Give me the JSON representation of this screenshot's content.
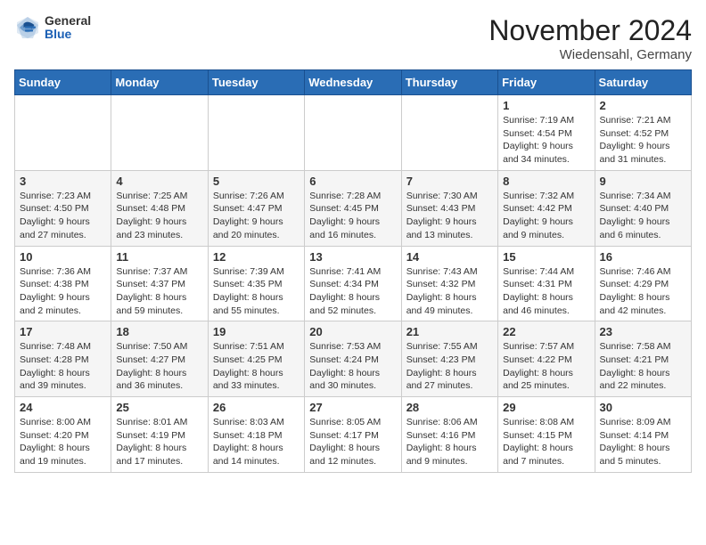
{
  "header": {
    "logo_general": "General",
    "logo_blue": "Blue",
    "month_title": "November 2024",
    "location": "Wiedensahl, Germany"
  },
  "days_of_week": [
    "Sunday",
    "Monday",
    "Tuesday",
    "Wednesday",
    "Thursday",
    "Friday",
    "Saturday"
  ],
  "weeks": [
    [
      {
        "day": "",
        "info": ""
      },
      {
        "day": "",
        "info": ""
      },
      {
        "day": "",
        "info": ""
      },
      {
        "day": "",
        "info": ""
      },
      {
        "day": "",
        "info": ""
      },
      {
        "day": "1",
        "info": "Sunrise: 7:19 AM\nSunset: 4:54 PM\nDaylight: 9 hours and 34 minutes."
      },
      {
        "day": "2",
        "info": "Sunrise: 7:21 AM\nSunset: 4:52 PM\nDaylight: 9 hours and 31 minutes."
      }
    ],
    [
      {
        "day": "3",
        "info": "Sunrise: 7:23 AM\nSunset: 4:50 PM\nDaylight: 9 hours and 27 minutes."
      },
      {
        "day": "4",
        "info": "Sunrise: 7:25 AM\nSunset: 4:48 PM\nDaylight: 9 hours and 23 minutes."
      },
      {
        "day": "5",
        "info": "Sunrise: 7:26 AM\nSunset: 4:47 PM\nDaylight: 9 hours and 20 minutes."
      },
      {
        "day": "6",
        "info": "Sunrise: 7:28 AM\nSunset: 4:45 PM\nDaylight: 9 hours and 16 minutes."
      },
      {
        "day": "7",
        "info": "Sunrise: 7:30 AM\nSunset: 4:43 PM\nDaylight: 9 hours and 13 minutes."
      },
      {
        "day": "8",
        "info": "Sunrise: 7:32 AM\nSunset: 4:42 PM\nDaylight: 9 hours and 9 minutes."
      },
      {
        "day": "9",
        "info": "Sunrise: 7:34 AM\nSunset: 4:40 PM\nDaylight: 9 hours and 6 minutes."
      }
    ],
    [
      {
        "day": "10",
        "info": "Sunrise: 7:36 AM\nSunset: 4:38 PM\nDaylight: 9 hours and 2 minutes."
      },
      {
        "day": "11",
        "info": "Sunrise: 7:37 AM\nSunset: 4:37 PM\nDaylight: 8 hours and 59 minutes."
      },
      {
        "day": "12",
        "info": "Sunrise: 7:39 AM\nSunset: 4:35 PM\nDaylight: 8 hours and 55 minutes."
      },
      {
        "day": "13",
        "info": "Sunrise: 7:41 AM\nSunset: 4:34 PM\nDaylight: 8 hours and 52 minutes."
      },
      {
        "day": "14",
        "info": "Sunrise: 7:43 AM\nSunset: 4:32 PM\nDaylight: 8 hours and 49 minutes."
      },
      {
        "day": "15",
        "info": "Sunrise: 7:44 AM\nSunset: 4:31 PM\nDaylight: 8 hours and 46 minutes."
      },
      {
        "day": "16",
        "info": "Sunrise: 7:46 AM\nSunset: 4:29 PM\nDaylight: 8 hours and 42 minutes."
      }
    ],
    [
      {
        "day": "17",
        "info": "Sunrise: 7:48 AM\nSunset: 4:28 PM\nDaylight: 8 hours and 39 minutes."
      },
      {
        "day": "18",
        "info": "Sunrise: 7:50 AM\nSunset: 4:27 PM\nDaylight: 8 hours and 36 minutes."
      },
      {
        "day": "19",
        "info": "Sunrise: 7:51 AM\nSunset: 4:25 PM\nDaylight: 8 hours and 33 minutes."
      },
      {
        "day": "20",
        "info": "Sunrise: 7:53 AM\nSunset: 4:24 PM\nDaylight: 8 hours and 30 minutes."
      },
      {
        "day": "21",
        "info": "Sunrise: 7:55 AM\nSunset: 4:23 PM\nDaylight: 8 hours and 27 minutes."
      },
      {
        "day": "22",
        "info": "Sunrise: 7:57 AM\nSunset: 4:22 PM\nDaylight: 8 hours and 25 minutes."
      },
      {
        "day": "23",
        "info": "Sunrise: 7:58 AM\nSunset: 4:21 PM\nDaylight: 8 hours and 22 minutes."
      }
    ],
    [
      {
        "day": "24",
        "info": "Sunrise: 8:00 AM\nSunset: 4:20 PM\nDaylight: 8 hours and 19 minutes."
      },
      {
        "day": "25",
        "info": "Sunrise: 8:01 AM\nSunset: 4:19 PM\nDaylight: 8 hours and 17 minutes."
      },
      {
        "day": "26",
        "info": "Sunrise: 8:03 AM\nSunset: 4:18 PM\nDaylight: 8 hours and 14 minutes."
      },
      {
        "day": "27",
        "info": "Sunrise: 8:05 AM\nSunset: 4:17 PM\nDaylight: 8 hours and 12 minutes."
      },
      {
        "day": "28",
        "info": "Sunrise: 8:06 AM\nSunset: 4:16 PM\nDaylight: 8 hours and 9 minutes."
      },
      {
        "day": "29",
        "info": "Sunrise: 8:08 AM\nSunset: 4:15 PM\nDaylight: 8 hours and 7 minutes."
      },
      {
        "day": "30",
        "info": "Sunrise: 8:09 AM\nSunset: 4:14 PM\nDaylight: 8 hours and 5 minutes."
      }
    ]
  ]
}
